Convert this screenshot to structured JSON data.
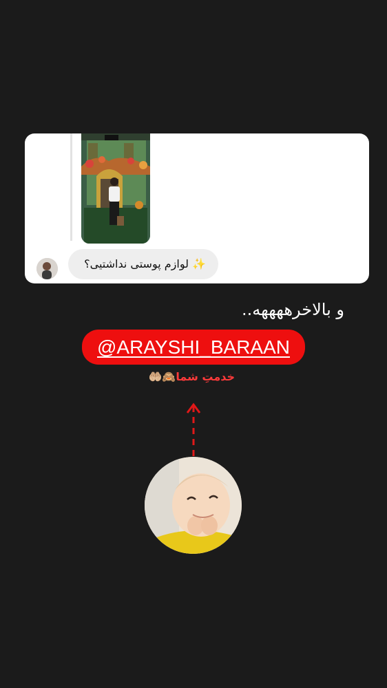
{
  "reply_card": {
    "message_text": "لوازم پوستی نداشتیی؟",
    "sparkle_emoji": "✨"
  },
  "story": {
    "caption": "و بالاخرههههه..",
    "mention": "@ARAYSHI_BARAAN",
    "service_text": "خدمتِ شما",
    "service_emoji": "🙈🤲🏼"
  },
  "colors": {
    "background": "#1b1b1b",
    "mention_bg": "#ee0f0f",
    "service_text": "#ff3a3a",
    "bubble_bg": "#eeeeee"
  },
  "icons": [
    "reply-photo-icon",
    "sender-avatar-icon",
    "up-arrow-icon",
    "baby-sticker-icon"
  ]
}
